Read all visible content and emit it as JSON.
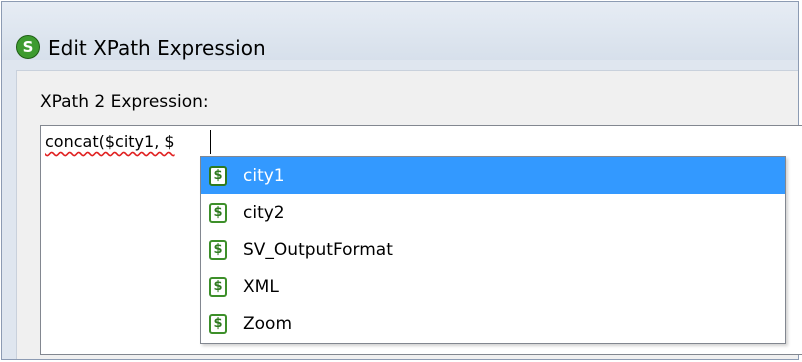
{
  "window": {
    "title": "Edit XPath Expression",
    "icon": "altova-logo-icon",
    "icon_glyph": "S"
  },
  "expression": {
    "label": "XPath 2 Expression:",
    "value": "concat($city1, $"
  },
  "autocomplete": {
    "icon_glyph": "$",
    "items": [
      {
        "label": "city1",
        "selected": true
      },
      {
        "label": "city2",
        "selected": false
      },
      {
        "label": "SV_OutputFormat",
        "selected": false
      },
      {
        "label": "XML",
        "selected": false
      },
      {
        "label": "Zoom",
        "selected": false
      }
    ]
  },
  "colors": {
    "selection": "#3399ff",
    "variable_icon": "#3d8f2a",
    "spellcheck_underline": "#e02020"
  }
}
